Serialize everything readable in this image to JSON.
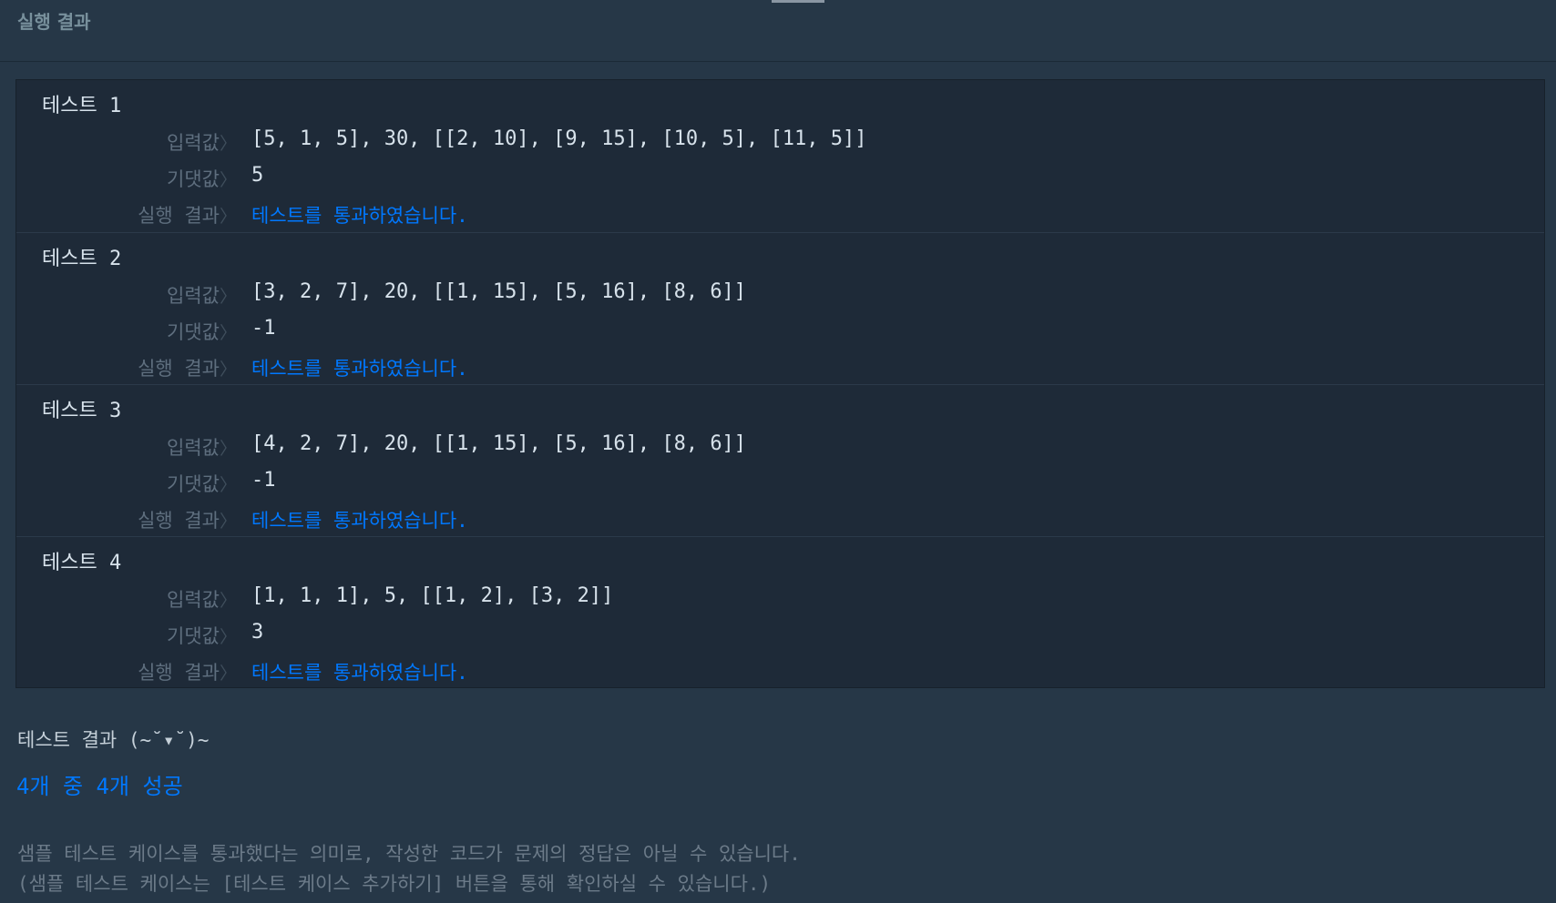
{
  "panel": {
    "title": "실행 결과"
  },
  "labels": {
    "input": "입력값",
    "expected": "기댓값",
    "result": "실행 결과",
    "chevron": "〉"
  },
  "tests": [
    {
      "title": "테스트 1",
      "input": "[5, 1, 5], 30, [[2, 10], [9, 15], [10, 5], [11, 5]]",
      "expected": "5",
      "result": "테스트를 통과하였습니다."
    },
    {
      "title": "테스트 2",
      "input": "[3, 2, 7], 20, [[1, 15], [5, 16], [8, 6]]",
      "expected": "-1",
      "result": "테스트를 통과하였습니다."
    },
    {
      "title": "테스트 3",
      "input": "[4, 2, 7], 20, [[1, 15], [5, 16], [8, 6]]",
      "expected": "-1",
      "result": "테스트를 통과하였습니다."
    },
    {
      "title": "테스트 4",
      "input": "[1, 1, 1], 5, [[1, 2], [3, 2]]",
      "expected": "3",
      "result": "테스트를 통과하였습니다."
    }
  ],
  "summary": {
    "title": "테스트 결과 (~˘▾˘)~",
    "score": "4개 중 4개 성공",
    "note_line1": "샘플 테스트 케이스를 통과했다는 의미로, 작성한 코드가 문제의 정답은 아닐 수 있습니다.",
    "note_line2": "(샘플 테스트 케이스는 [테스트 케이스 추가하기] 버튼을 통해 확인하실 수 있습니다.)"
  },
  "colors": {
    "background": "#263747",
    "box": "#1e2a38",
    "pass": "#0078ff",
    "text": "#d7e2eb",
    "label": "#5e6e7e"
  }
}
